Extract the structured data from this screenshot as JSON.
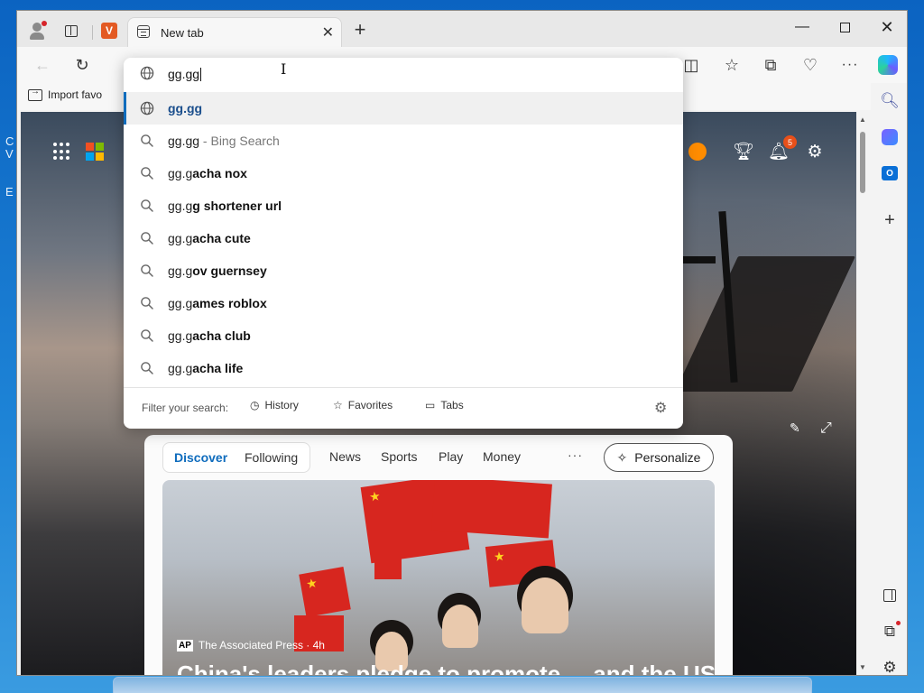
{
  "browser": {
    "tab_title": "New tab",
    "favorites_bar_item": "Import favo"
  },
  "address": {
    "typed": "gg.gg"
  },
  "suggestions": [
    {
      "match": "gg.gg",
      "rest": "",
      "sub": "",
      "icon": "globe-icon",
      "selected": true
    },
    {
      "match": "gg.gg",
      "rest": "",
      "sub": " - Bing Search",
      "icon": "search-icon",
      "selected": false
    },
    {
      "match": "gg.g",
      "rest": "acha nox",
      "sub": "",
      "icon": "search-icon",
      "selected": false
    },
    {
      "match": "gg.g",
      "rest": "g shortener url",
      "sub": "",
      "icon": "search-icon",
      "selected": false
    },
    {
      "match": "gg.g",
      "rest": "acha cute",
      "sub": "",
      "icon": "search-icon",
      "selected": false
    },
    {
      "match": "gg.g",
      "rest": "ov guernsey",
      "sub": "",
      "icon": "search-icon",
      "selected": false
    },
    {
      "match": "gg.g",
      "rest": "ames roblox",
      "sub": "",
      "icon": "search-icon",
      "selected": false
    },
    {
      "match": "gg.g",
      "rest": "acha club",
      "sub": "",
      "icon": "search-icon",
      "selected": false
    },
    {
      "match": "gg.g",
      "rest": "acha life",
      "sub": "",
      "icon": "search-icon",
      "selected": false
    }
  ],
  "filter": {
    "label": "Filter your search:",
    "history": "History",
    "favorites": "Favorites",
    "tabs": "Tabs"
  },
  "ntp": {
    "notification_count": "5"
  },
  "feed": {
    "discover": "Discover",
    "following": "Following",
    "tabs": [
      "News",
      "Sports",
      "Play",
      "Money"
    ],
    "more": "···",
    "personalize": "Personalize",
    "source": "The Associated Press · 4h",
    "source_logo": "AP",
    "headline": "China's leaders pledge to promote ... and the US"
  },
  "colors": {
    "accent": "#0f6cbd",
    "badge": "#e8501a"
  }
}
